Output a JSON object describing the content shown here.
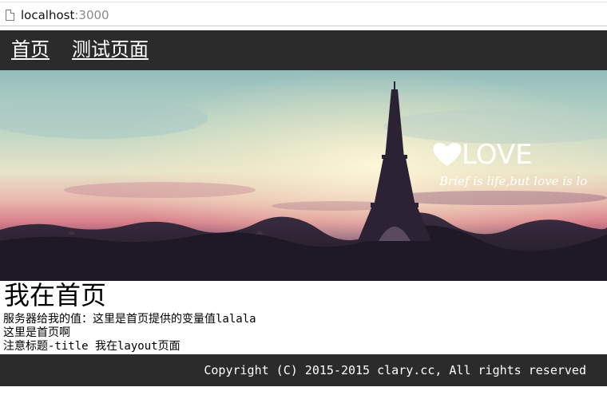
{
  "browser": {
    "url_host": "localhost",
    "url_port": ":3000"
  },
  "nav": {
    "items": [
      {
        "label": "首页"
      },
      {
        "label": "测试页面"
      }
    ]
  },
  "banner": {
    "love_text": "LOVE",
    "tagline": "Brief is life,but love is lo",
    "icons": [
      "heart-icon",
      "eiffel-tower-icon"
    ],
    "colors": {
      "sky_top": "#9fc8c6",
      "sky_glow": "#f2f0d2",
      "sky_pink": "#e79aa0",
      "ground": "#241c2c"
    }
  },
  "main": {
    "heading": "我在首页",
    "server_value_line": "服务器给我的值：这里是首页提供的变量值lalala",
    "homepage_line": "这里是首页啊",
    "note_line": "注意标题-title 我在layout页面"
  },
  "footer": {
    "copyright": "Copyright (C) 2015-2015 clary.cc, All rights reserved"
  }
}
